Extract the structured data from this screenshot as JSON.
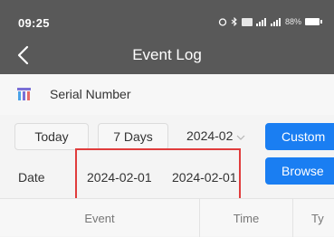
{
  "status_bar": {
    "time": "09:25",
    "battery_text": "88%"
  },
  "header": {
    "title": "Event Log",
    "back_icon": "chevron-left-icon",
    "background_color": "#595959"
  },
  "serial": {
    "icon": "device-icon",
    "label": "Serial Number"
  },
  "filters": {
    "today_label": "Today",
    "seven_days_label": "7 Days",
    "month_value": "2024-02",
    "custom_label": "Custom"
  },
  "date_range": {
    "label": "Date",
    "start": "2024-02-01",
    "end": "2024-02-01",
    "browse_label": "Browse"
  },
  "table": {
    "columns": [
      "Event",
      "Time",
      "Ty"
    ]
  },
  "colors": {
    "accent": "#1a7ef2",
    "highlight": "#e03c3c"
  }
}
